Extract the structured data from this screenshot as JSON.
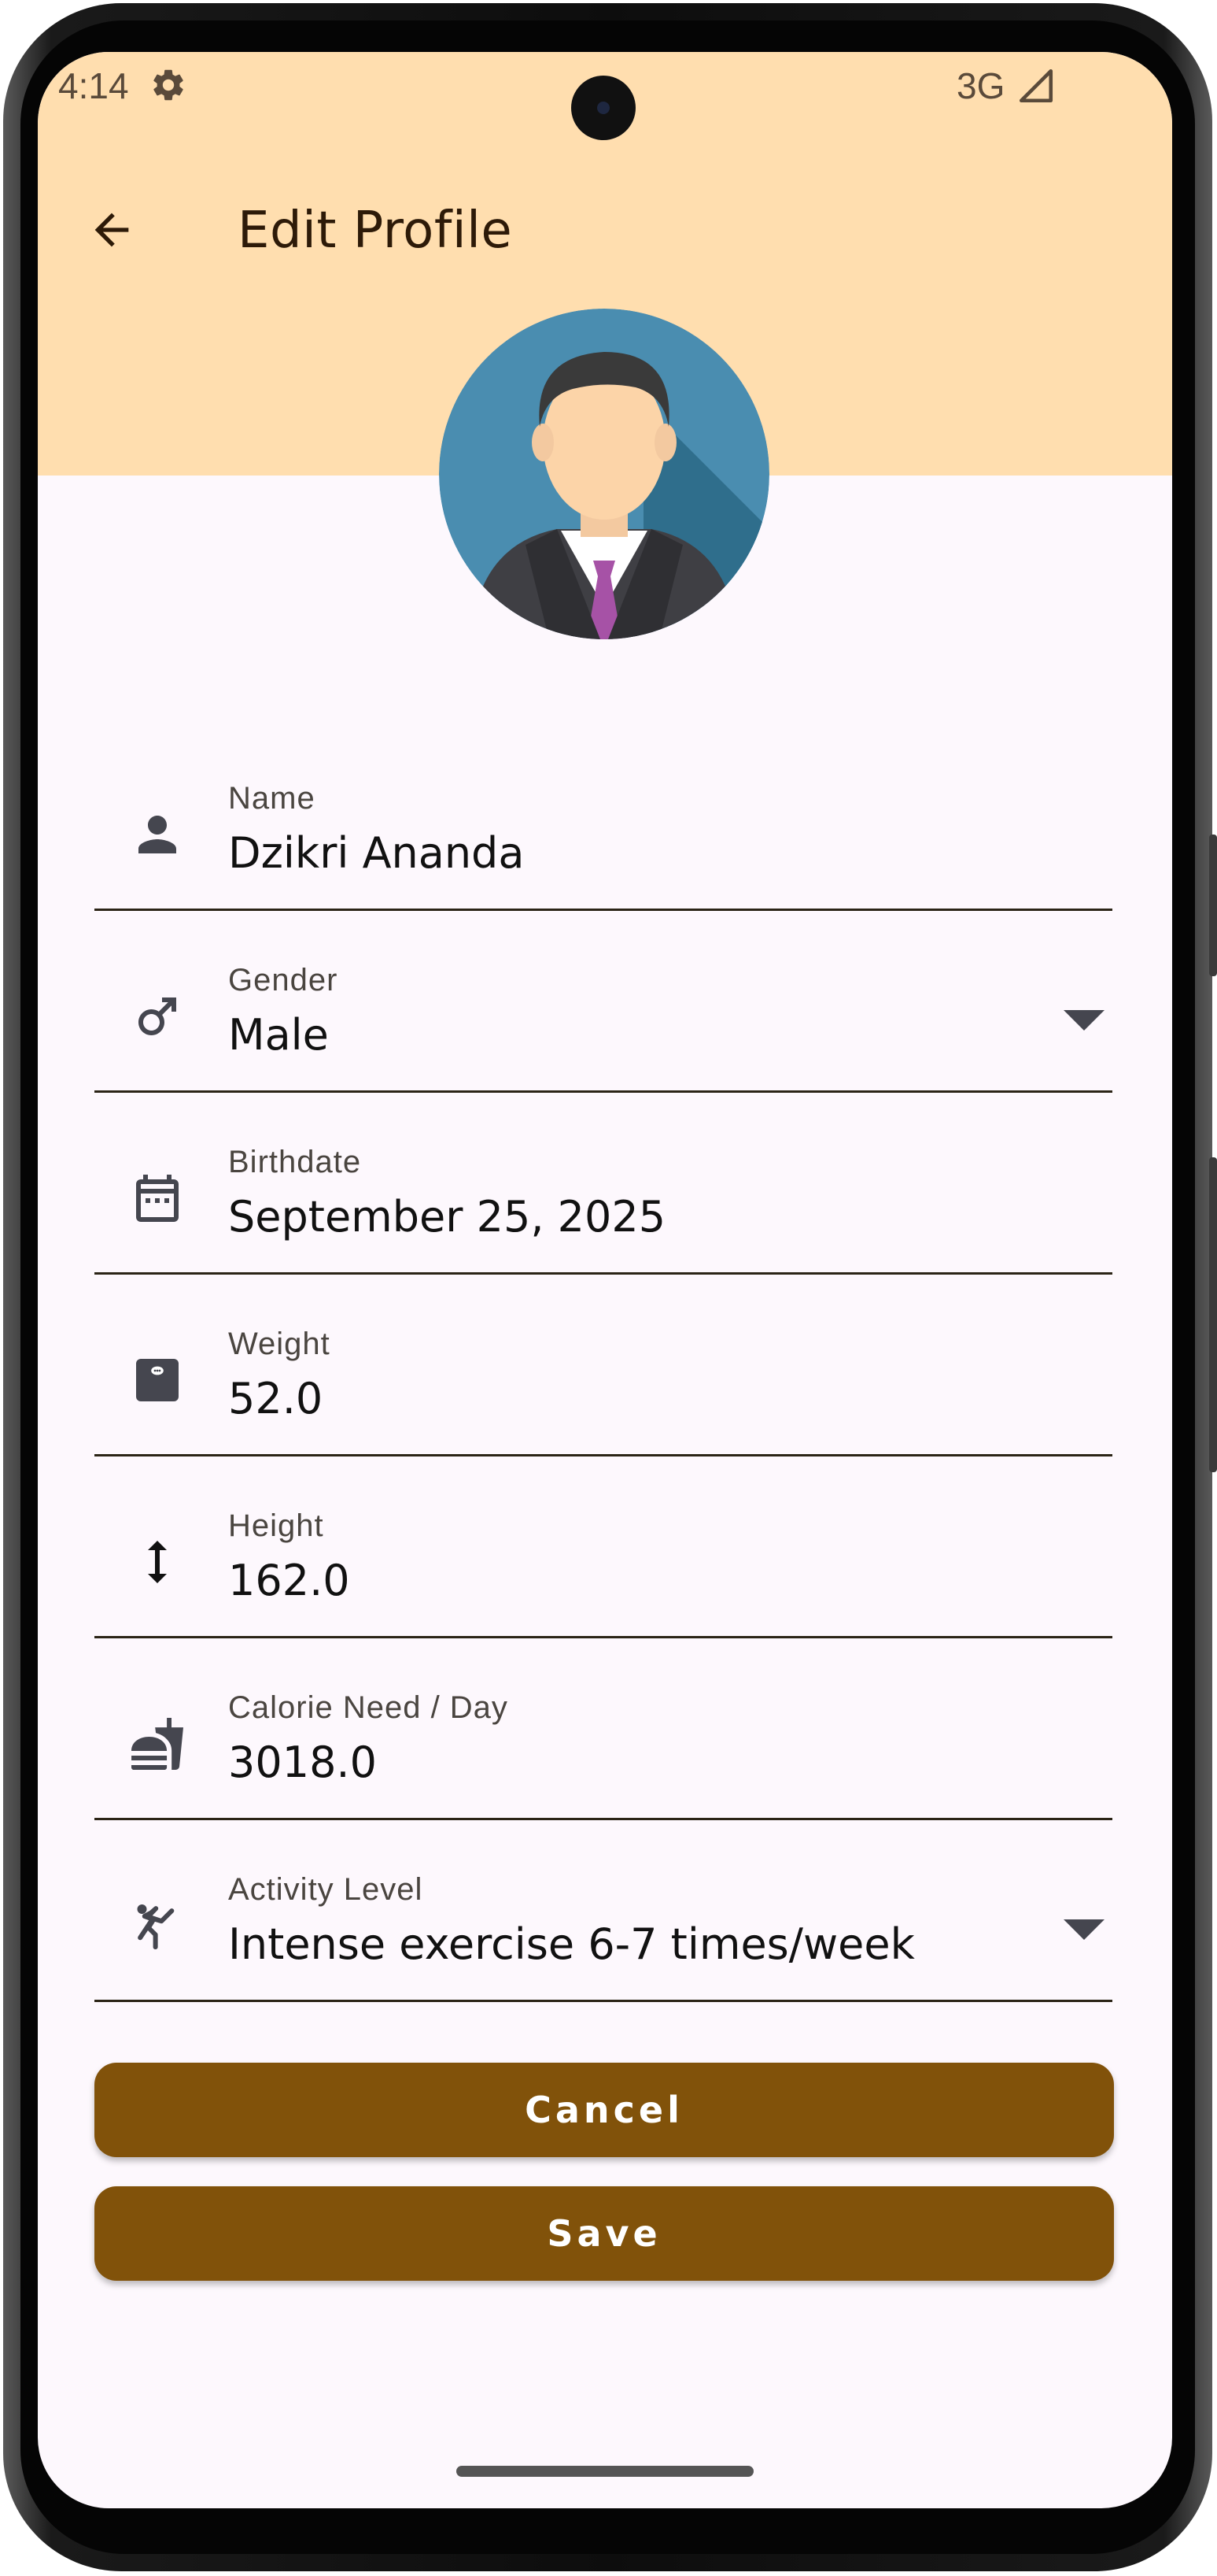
{
  "status_bar": {
    "time": "4:14",
    "network": "3G"
  },
  "appbar": {
    "title": "Edit Profile"
  },
  "fields": [
    {
      "label": "Name",
      "value": "Dzikri Ananda",
      "icon": "person-icon"
    },
    {
      "label": "Gender",
      "value": "Male",
      "icon": "male-icon"
    },
    {
      "label": "Birthdate",
      "value": "September 25, 2025",
      "icon": "calendar-icon"
    },
    {
      "label": "Weight",
      "value": "52.0",
      "icon": "scale-icon"
    },
    {
      "label": "Height",
      "value": "162.0",
      "icon": "height-icon"
    },
    {
      "label": "Calorie Need / Day",
      "value": "3018.0",
      "icon": "fastfood-icon"
    },
    {
      "label": "Activity Level",
      "value": "Intense exercise 6-7 times/week",
      "icon": "kick-icon"
    }
  ],
  "buttons": {
    "cancel": "Cancel",
    "save": "Save"
  },
  "colors": {
    "header": "#ffdeaf",
    "background": "#fdf8fd",
    "button": "#81520a",
    "divider": "#2b2416"
  }
}
